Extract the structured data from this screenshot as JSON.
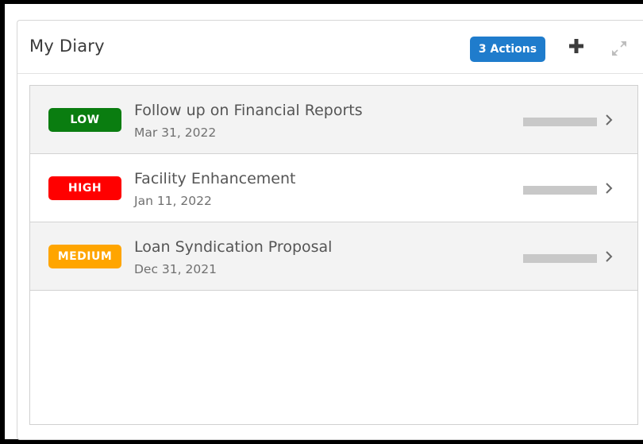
{
  "widget": {
    "title": "My Diary",
    "actions_label": "3 Actions",
    "add_icon": "plus-icon",
    "expand_icon": "expand-icon"
  },
  "items": [
    {
      "priority": "LOW",
      "priority_color": "#0a7d10",
      "title": "Follow up on Financial Reports",
      "date": "Mar 31, 2022"
    },
    {
      "priority": "HIGH",
      "priority_color": "#ff0000",
      "title": "Facility Enhancement",
      "date": "Jan 11, 2022"
    },
    {
      "priority": "MEDIUM",
      "priority_color": "#ffa500",
      "title": "Loan Syndication Proposal",
      "date": "Dec 31, 2021"
    }
  ],
  "colors": {
    "accent": "#1f7ccc",
    "row_alt_background": "#f3f3f3"
  }
}
